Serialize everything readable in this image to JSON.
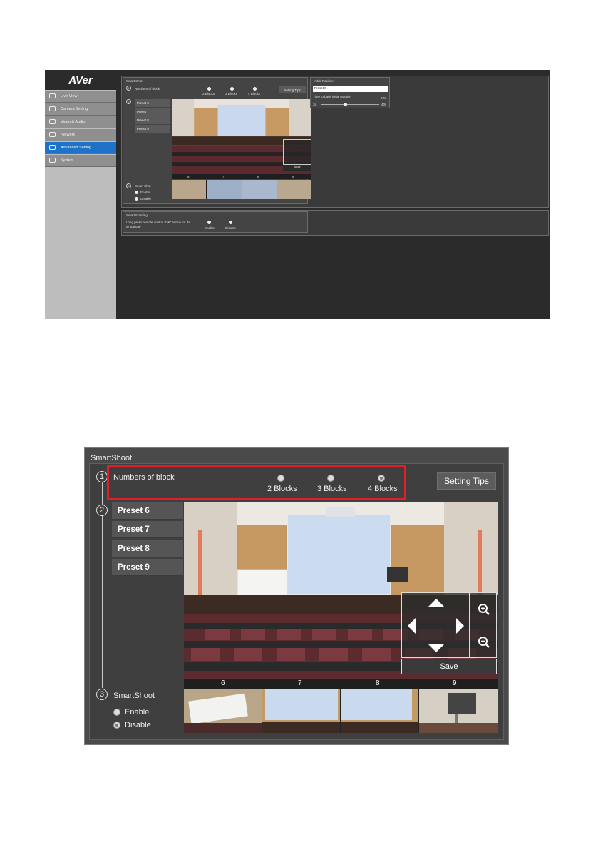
{
  "overview": {
    "logo": "AVer",
    "nav": [
      {
        "label": "Live View",
        "icon": "eye-icon",
        "active": false
      },
      {
        "label": "Camera Setting",
        "icon": "camera-setting-icon",
        "active": false
      },
      {
        "label": "Video & Audio",
        "icon": "video-audio-icon",
        "active": false
      },
      {
        "label": "Network",
        "icon": "network-icon",
        "active": false
      },
      {
        "label": "Advanced Setting",
        "icon": "advanced-setting-icon",
        "active": true
      },
      {
        "label": "System",
        "icon": "system-icon",
        "active": false
      }
    ],
    "smartshoot_title": "Smart Shot",
    "numbers_of_block_label": "Numbers of block",
    "block_options": [
      "2 Blocks",
      "3 Blocks",
      "4 Blocks"
    ],
    "setting_tips": "Setting Tips",
    "presets": [
      "Preset 6",
      "Preset 7",
      "Preset 8",
      "Preset 9"
    ],
    "save": "Save",
    "cam_numbers": [
      "6",
      "7",
      "8",
      "9"
    ],
    "smartshoot_label": "Smart Shot",
    "enable": "Enable",
    "disable": "Disable",
    "initial_position_title": "Initial Position",
    "initial_position_value": "Preset 0",
    "time_to_back_label": "Time to back initial position",
    "time_current": "20s",
    "time_min": "3s",
    "time_max": "40s",
    "smart_framing_title": "Smart Framing",
    "smart_framing_desc_1": "Long press remote control \"OK\" button for 3s",
    "smart_framing_desc_2": "to activate",
    "framing_enable": "Enable",
    "framing_disable": "Disable"
  },
  "detail": {
    "title": "SmartShoot",
    "step_numbers": [
      "1",
      "2",
      "3"
    ],
    "numbers_of_block_label": "Numbers of block",
    "block_options": [
      {
        "label": "2 Blocks",
        "selected": false
      },
      {
        "label": "3 Blocks",
        "selected": false
      },
      {
        "label": "4 Blocks",
        "selected": true
      }
    ],
    "setting_tips": "Setting Tips",
    "presets": [
      "Preset 6",
      "Preset 7",
      "Preset 8",
      "Preset 9"
    ],
    "save": "Save",
    "cam_numbers": [
      "6",
      "7",
      "8",
      "9"
    ],
    "smartshoot_label": "SmartShoot",
    "enable": "Enable",
    "disable": "Disable",
    "colors": {
      "highlight": "#e01f26",
      "active_nav": "#1e73c8"
    }
  }
}
